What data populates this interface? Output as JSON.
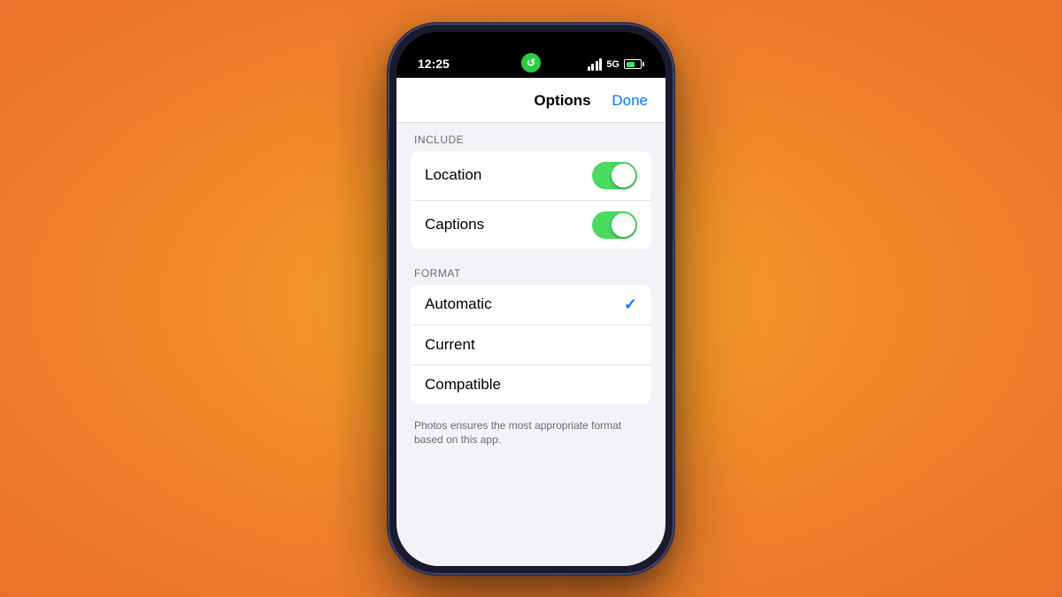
{
  "phone": {
    "status_bar": {
      "time": "12:25",
      "signal_text": "5G",
      "battery_text": "46"
    },
    "sheet": {
      "title": "Options",
      "done_label": "Done",
      "include_section": {
        "label": "INCLUDE",
        "rows": [
          {
            "label": "Location",
            "toggle": true
          },
          {
            "label": "Captions",
            "toggle": true
          }
        ]
      },
      "format_section": {
        "label": "FORMAT",
        "options": [
          {
            "label": "Automatic",
            "selected": true
          },
          {
            "label": "Current",
            "selected": false
          },
          {
            "label": "Compatible",
            "selected": false
          }
        ],
        "hint": "Photos ensures the most appropriate format based on this app."
      }
    }
  }
}
